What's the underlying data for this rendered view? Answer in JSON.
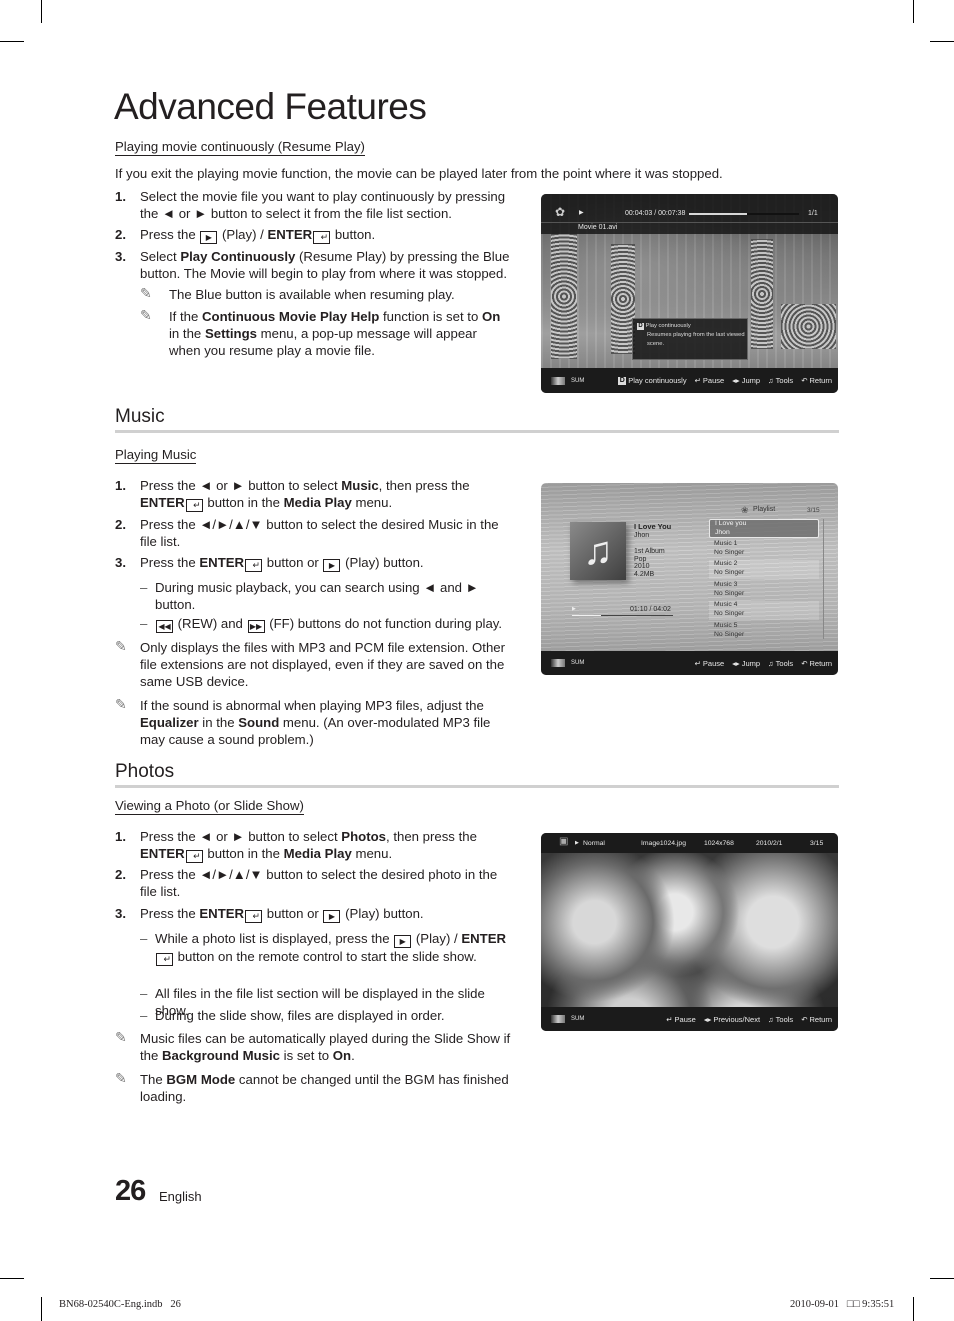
{
  "page": {
    "title": "Advanced Features",
    "number": "26",
    "language": "English",
    "print_file": "BN68-02540C-Eng.indb   26",
    "print_stamp": "2010-09-01   □□ 9:35:51"
  },
  "resume": {
    "heading": "Playing movie continuously (Resume Play)",
    "intro": "If you exit the playing movie function, the movie can be played later from the point where it was stopped.",
    "steps": [
      {
        "num": "1.",
        "text": "Select the movie file you want to play continuously by pressing the ◄ or ► button to select it from the file list section."
      },
      {
        "num": "2.",
        "pre": "Press the ",
        "mid": " (Play) / ",
        "bold": "ENTER",
        "post": " button."
      },
      {
        "num": "3.",
        "pre": "Select ",
        "bold": "Play Continuously",
        "post": " (Resume Play) by pressing the Blue button. The Movie will begin to play from where it was stopped."
      }
    ],
    "notes": [
      {
        "text": "The Blue button is available when resuming play."
      },
      {
        "pre": "If the ",
        "b1": "Continuous Movie Play Help",
        "m1": " function is set to ",
        "b2": "On",
        "m2": " in the ",
        "b3": "Settings",
        "post": " menu, a pop-up message will appear when you resume play a movie file."
      }
    ],
    "screen": {
      "time": "00:04:03 / 00:07:38",
      "progress": 0.53,
      "count": "1/1",
      "filename": "Movie 01.avi",
      "popup_key": "D",
      "popup_title": "Play continuously",
      "popup_body": "Resumes playing from the last viewed scene.",
      "sum": "SUM",
      "buttons": [
        {
          "key": "D",
          "label": "Play continuously"
        },
        {
          "icon": "enter-icon",
          "label": "Pause"
        },
        {
          "icon": "left-right-icon",
          "label": "Jump"
        },
        {
          "icon": "tools-icon",
          "label": "Tools"
        },
        {
          "icon": "return-icon",
          "label": "Return"
        }
      ]
    }
  },
  "music": {
    "section": "Music",
    "heading": "Playing Music",
    "steps": [
      {
        "num": "1.",
        "pre": "Press the ◄ or ► button to select ",
        "b1": "Music",
        "m1": ", then press the ",
        "b2": "ENTER",
        "m2": " button in the ",
        "b3": "Media Play",
        "post": " menu."
      },
      {
        "num": "2.",
        "text": "Press the ◄/►/▲/▼ button to select the desired Music in the file list."
      },
      {
        "num": "3.",
        "pre": "Press the ",
        "bold": "ENTER",
        "mid": " button or ",
        "post": " (Play) button."
      }
    ],
    "dashes": [
      "During music playback, you can search using ◄ and ► button.",
      {
        "a": " (REW) and ",
        "b": " (FF) buttons do not function during play."
      }
    ],
    "notes": [
      {
        "text": "Only displays the files with MP3 and PCM file extension. Other file extensions are not displayed, even if they are saved on the same USB device."
      },
      {
        "pre": "If the sound is abnormal when playing MP3 files, adjust the ",
        "b1": "Equalizer",
        "m1": " in the ",
        "b2": "Sound",
        "post": " menu. (An over-modulated MP3 file may cause a sound problem.)"
      }
    ],
    "screen": {
      "playlist_label": "Playlist",
      "count": "3/15",
      "song_title": "I Love You",
      "artist": "Jhon",
      "album": "1st Album",
      "genre": "Pop",
      "year": "2010",
      "size": "4.2MB",
      "time": "01:10 / 04:02",
      "progress": 0.29,
      "playlist": [
        {
          "title": "I Love you",
          "artist": "Jhon",
          "selected": true
        },
        {
          "title": "Music 1",
          "artist": "No Singer"
        },
        {
          "title": "Music 2",
          "artist": "No Singer"
        },
        {
          "title": "Music 3",
          "artist": "No Singer"
        },
        {
          "title": "Music 4",
          "artist": "No Singer"
        },
        {
          "title": "Music 5",
          "artist": "No Singer"
        }
      ],
      "sum": "SUM",
      "buttons": [
        "Pause",
        "Jump",
        "Tools",
        "Return"
      ]
    }
  },
  "photos": {
    "section": "Photos",
    "heading": "Viewing a Photo (or Slide Show)",
    "steps": [
      {
        "num": "1.",
        "pre": "Press the ◄ or ► button to select ",
        "b1": "Photos",
        "m1": ", then press the ",
        "b2": "ENTER",
        "m2": " button in the ",
        "b3": "Media Play",
        "post": " menu."
      },
      {
        "num": "2.",
        "text": "Press the ◄/►/▲/▼ button to select the desired photo in the file list."
      },
      {
        "num": "3.",
        "pre": "Press the ",
        "bold": "ENTER",
        "mid": " button or ",
        "post": " (Play) button."
      }
    ],
    "dashes": [
      {
        "pre": "While a photo list is displayed, press the ",
        "mid": " (Play) / ",
        "bold": "ENTER",
        "post": " button on the remote control to start the slide show."
      },
      "All files in the file list section will be displayed in the slide show.",
      "During the slide show, files are displayed in order."
    ],
    "notes": [
      {
        "pre": "Music files can be automatically played during the Slide Show if the ",
        "b1": "Background Music",
        "m1": " is set to ",
        "b2": "On",
        "post": "."
      },
      {
        "pre": "The ",
        "b1": "BGM Mode",
        "post": " cannot be changed until the BGM has finished loading."
      }
    ],
    "screen": {
      "mode": "Normal",
      "filename": "Image1024.jpg",
      "resolution": "1024x768",
      "date": "2010/2/1",
      "count": "3/15",
      "sum": "SUM",
      "buttons": [
        "Pause",
        "Previous/Next",
        "Tools",
        "Return"
      ]
    }
  }
}
